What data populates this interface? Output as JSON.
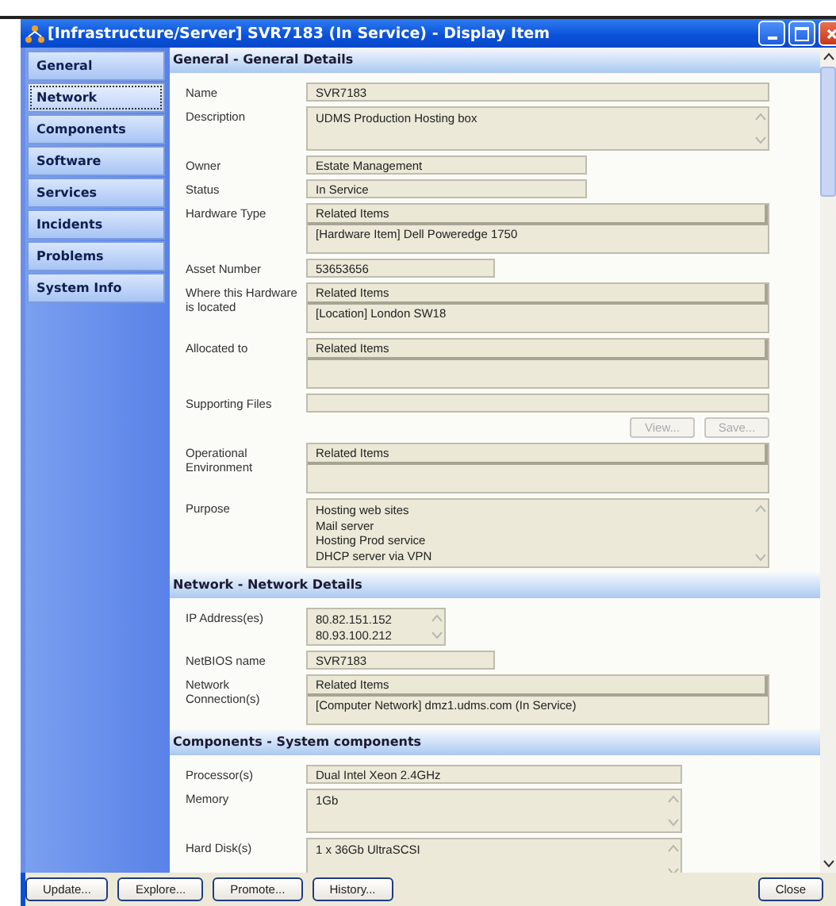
{
  "window": {
    "title": "[Infrastructure/Server] SVR7183 (In Service) - Display Item"
  },
  "sidebar": {
    "items": [
      {
        "label": "General",
        "selected": false
      },
      {
        "label": "Network",
        "selected": true
      },
      {
        "label": "Components",
        "selected": false
      },
      {
        "label": "Software",
        "selected": false
      },
      {
        "label": "Services",
        "selected": false
      },
      {
        "label": "Incidents",
        "selected": false
      },
      {
        "label": "Problems",
        "selected": false
      },
      {
        "label": "System Info",
        "selected": false
      }
    ]
  },
  "sections": [
    {
      "title": "General - General Details",
      "fields": [
        {
          "label": "Name",
          "kind": "line",
          "value": "SVR7183"
        },
        {
          "label": "Description",
          "kind": "memo",
          "lines": [
            "UDMS Production Hosting box"
          ]
        },
        {
          "label": "Owner",
          "kind": "shortline",
          "value": "Estate Management"
        },
        {
          "label": "Status",
          "kind": "shortline",
          "value": "In Service"
        },
        {
          "label": "Hardware Type",
          "kind": "related",
          "header": "Related Items",
          "lines": [
            "[Hardware Item] Dell Poweredge 1750"
          ]
        },
        {
          "label": "Asset Number",
          "kind": "tinyline",
          "value": "53653656"
        },
        {
          "label": "Where this Hardware is located",
          "kind": "related",
          "header": "Related Items",
          "lines": [
            "[Location] London SW18"
          ]
        },
        {
          "label": "Allocated to",
          "kind": "related",
          "header": "Related Items"
        },
        {
          "label": "Supporting Files",
          "kind": "files",
          "buttons": [
            {
              "label": "View...",
              "disabled": true
            },
            {
              "label": "Save...",
              "disabled": true
            }
          ]
        },
        {
          "label": "Operational Environment",
          "kind": "related",
          "header": "Related Items"
        },
        {
          "label": "Purpose",
          "kind": "memo",
          "lines": [
            "Hosting web sites",
            "Mail server",
            "Hosting Prod service",
            "DHCP server via VPN"
          ]
        }
      ]
    },
    {
      "title": "Network - Network Details",
      "fields": [
        {
          "label": "IP Address(es)",
          "kind": "tinymemo",
          "lines": [
            "80.82.151.152",
            "80.93.100.212"
          ]
        },
        {
          "label": "NetBIOS name",
          "kind": "tinyline",
          "value": "SVR7183"
        },
        {
          "label": "Network Connection(s)",
          "kind": "related",
          "header": "Related Items",
          "lines": [
            "[Computer Network] dmz1.udms.com (In Service)"
          ]
        }
      ]
    },
    {
      "title": "Components - System components",
      "fields": [
        {
          "label": "Processor(s)",
          "kind": "midline",
          "value": "Dual Intel Xeon 2.4GHz"
        },
        {
          "label": "Memory",
          "kind": "midmemo",
          "lines": [
            "1Gb"
          ]
        },
        {
          "label": "Hard Disk(s)",
          "kind": "midmemo",
          "lines": [
            "1 x 36Gb UltraSCSI"
          ]
        }
      ]
    }
  ],
  "left_buttons": [
    "Update...",
    "Explore...",
    "Promote...",
    "History..."
  ],
  "right_buttons": [
    "Close"
  ]
}
